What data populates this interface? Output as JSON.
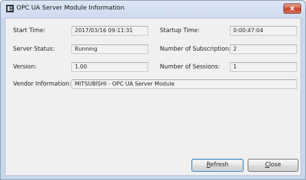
{
  "window": {
    "title": "OPC UA Server Module Information",
    "close_label": "x"
  },
  "fields": {
    "start_time": {
      "label": "Start Time:",
      "value": "2017/03/16 09:11:31"
    },
    "startup_time": {
      "label": "Startup Time:",
      "value": "0:00:47:04"
    },
    "server_status": {
      "label": "Server Status:",
      "value": "Running"
    },
    "subscriptions": {
      "label": "Number of Subscription:",
      "value": "2"
    },
    "version": {
      "label": "Version:",
      "value": "1.00"
    },
    "sessions": {
      "label": "Number of Sessions:",
      "value": "1"
    },
    "vendor": {
      "label": "Vendor Information:",
      "value": "MITSUBISHI - OPC UA Server Module"
    }
  },
  "buttons": {
    "refresh": {
      "mnemonic": "R",
      "rest": "efresh"
    },
    "close": {
      "mnemonic": "C",
      "rest": "lose"
    }
  }
}
